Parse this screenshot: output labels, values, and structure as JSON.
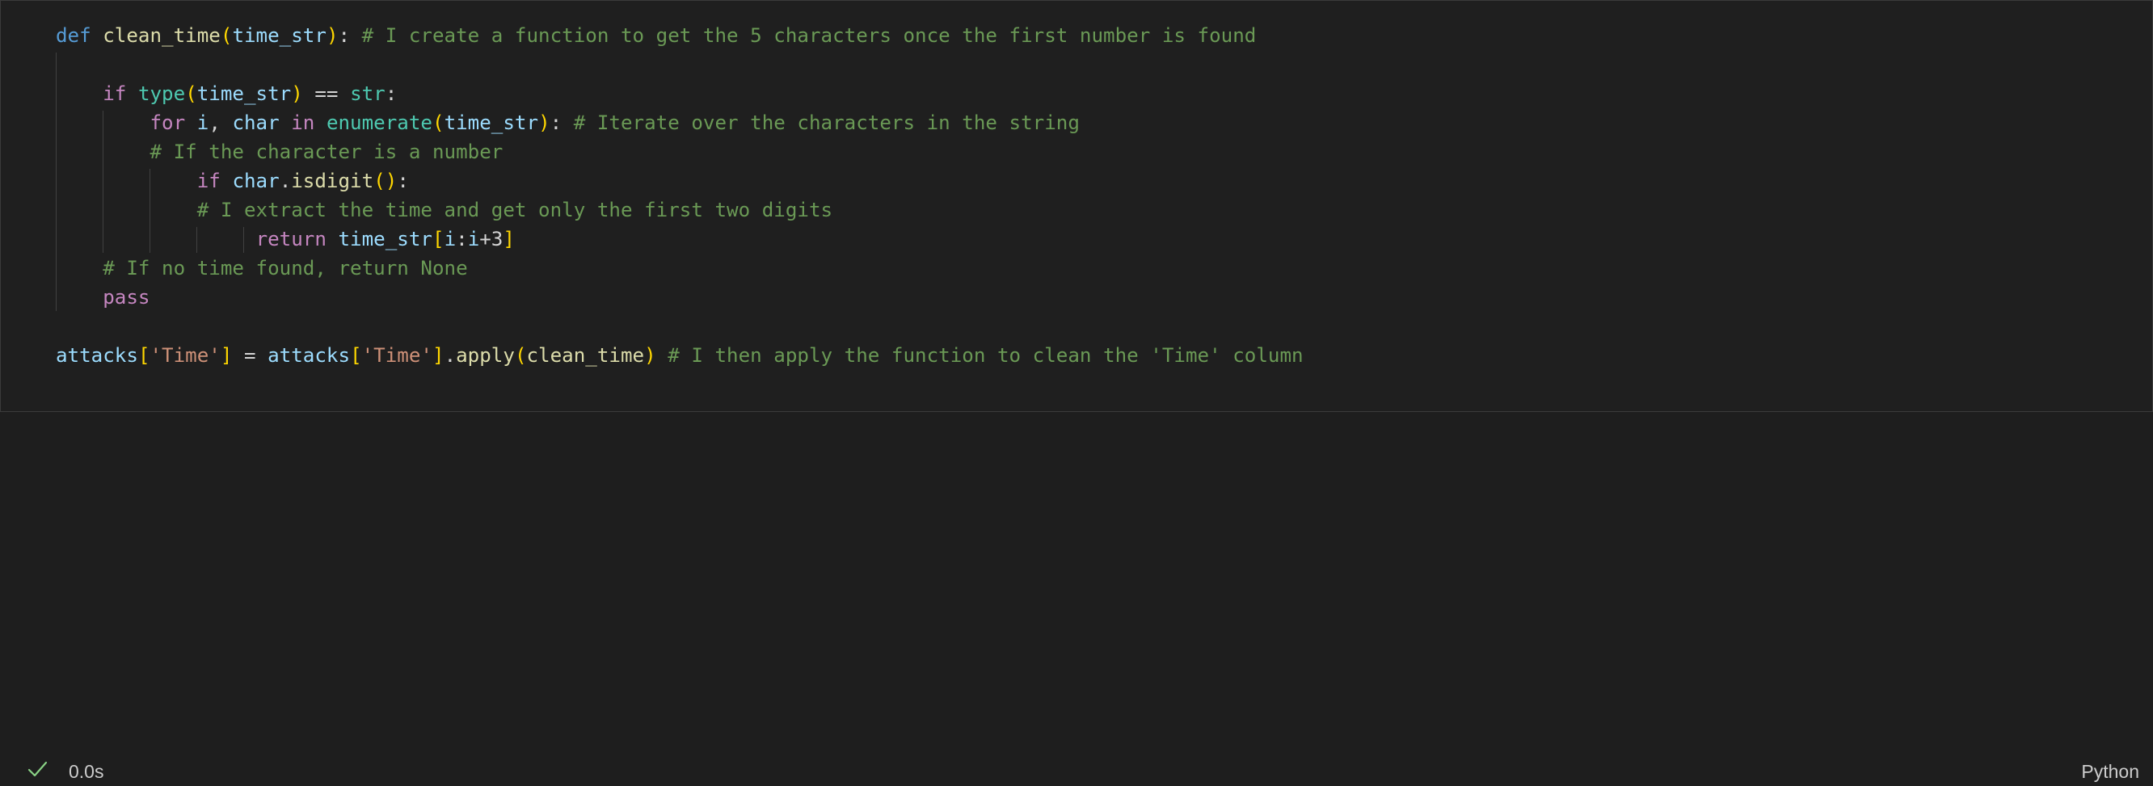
{
  "cell": {
    "language": "Python",
    "status": "success",
    "execution_time": "0.0s",
    "status_icon": "check-icon",
    "lines": [
      {
        "tokens": [
          {
            "t": "def",
            "c": "kw-def"
          },
          {
            "t": " "
          },
          {
            "t": "clean_time",
            "c": "fn"
          },
          {
            "t": "(",
            "c": "br1"
          },
          {
            "t": "time_str",
            "c": "param"
          },
          {
            "t": ")",
            "c": "br1"
          },
          {
            "t": ": "
          },
          {
            "t": "# I create a function to get the 5 characters once the first number is found",
            "c": "cm"
          }
        ]
      },
      {
        "tokens": []
      },
      {
        "tokens": [
          {
            "t": "    "
          },
          {
            "t": "if",
            "c": "kw"
          },
          {
            "t": " "
          },
          {
            "t": "type",
            "c": "cls"
          },
          {
            "t": "(",
            "c": "br1"
          },
          {
            "t": "time_str",
            "c": "var"
          },
          {
            "t": ")",
            "c": "br1"
          },
          {
            "t": " == "
          },
          {
            "t": "str",
            "c": "cls"
          },
          {
            "t": ":"
          }
        ]
      },
      {
        "tokens": [
          {
            "t": "        "
          },
          {
            "t": "for",
            "c": "kw"
          },
          {
            "t": " "
          },
          {
            "t": "i",
            "c": "var"
          },
          {
            "t": ", "
          },
          {
            "t": "char",
            "c": "var"
          },
          {
            "t": " "
          },
          {
            "t": "in",
            "c": "kw"
          },
          {
            "t": " "
          },
          {
            "t": "enumerate",
            "c": "cls"
          },
          {
            "t": "(",
            "c": "br1"
          },
          {
            "t": "time_str",
            "c": "var"
          },
          {
            "t": ")",
            "c": "br1"
          },
          {
            "t": ": "
          },
          {
            "t": "# Iterate over the characters in the string",
            "c": "cm"
          }
        ]
      },
      {
        "tokens": [
          {
            "t": "        "
          },
          {
            "t": "# If the character is a number",
            "c": "cm"
          }
        ]
      },
      {
        "tokens": [
          {
            "t": "            "
          },
          {
            "t": "if",
            "c": "kw"
          },
          {
            "t": " "
          },
          {
            "t": "char",
            "c": "var"
          },
          {
            "t": "."
          },
          {
            "t": "isdigit",
            "c": "fn"
          },
          {
            "t": "()",
            "c": "br1"
          },
          {
            "t": ":"
          }
        ]
      },
      {
        "tokens": [
          {
            "t": "            "
          },
          {
            "t": "# I extract the time and get only the first two digits",
            "c": "cm"
          }
        ]
      },
      {
        "tokens": [
          {
            "t": "                 "
          },
          {
            "t": "return",
            "c": "kw"
          },
          {
            "t": " "
          },
          {
            "t": "time_str",
            "c": "var"
          },
          {
            "t": "[",
            "c": "br1"
          },
          {
            "t": "i",
            "c": "var"
          },
          {
            "t": ":"
          },
          {
            "t": "i",
            "c": "var"
          },
          {
            "t": "+3"
          },
          {
            "t": "]",
            "c": "br1"
          }
        ]
      },
      {
        "tokens": [
          {
            "t": "    "
          },
          {
            "t": "# If no time found, return None",
            "c": "cm"
          }
        ]
      },
      {
        "tokens": [
          {
            "t": "    "
          },
          {
            "t": "pass",
            "c": "kw"
          }
        ]
      },
      {
        "tokens": []
      },
      {
        "tokens": [
          {
            "t": "attacks",
            "c": "var"
          },
          {
            "t": "[",
            "c": "br1"
          },
          {
            "t": "'Time'",
            "c": "str"
          },
          {
            "t": "]",
            "c": "br1"
          },
          {
            "t": " = "
          },
          {
            "t": "attacks",
            "c": "var"
          },
          {
            "t": "[",
            "c": "br1"
          },
          {
            "t": "'Time'",
            "c": "str"
          },
          {
            "t": "]",
            "c": "br1"
          },
          {
            "t": "."
          },
          {
            "t": "apply",
            "c": "fn"
          },
          {
            "t": "(",
            "c": "br1"
          },
          {
            "t": "clean_time",
            "c": "fn"
          },
          {
            "t": ")",
            "c": "br1"
          },
          {
            "t": " "
          },
          {
            "t": "# I then apply the function to clean the 'Time' column",
            "c": "cm"
          }
        ]
      }
    ]
  }
}
